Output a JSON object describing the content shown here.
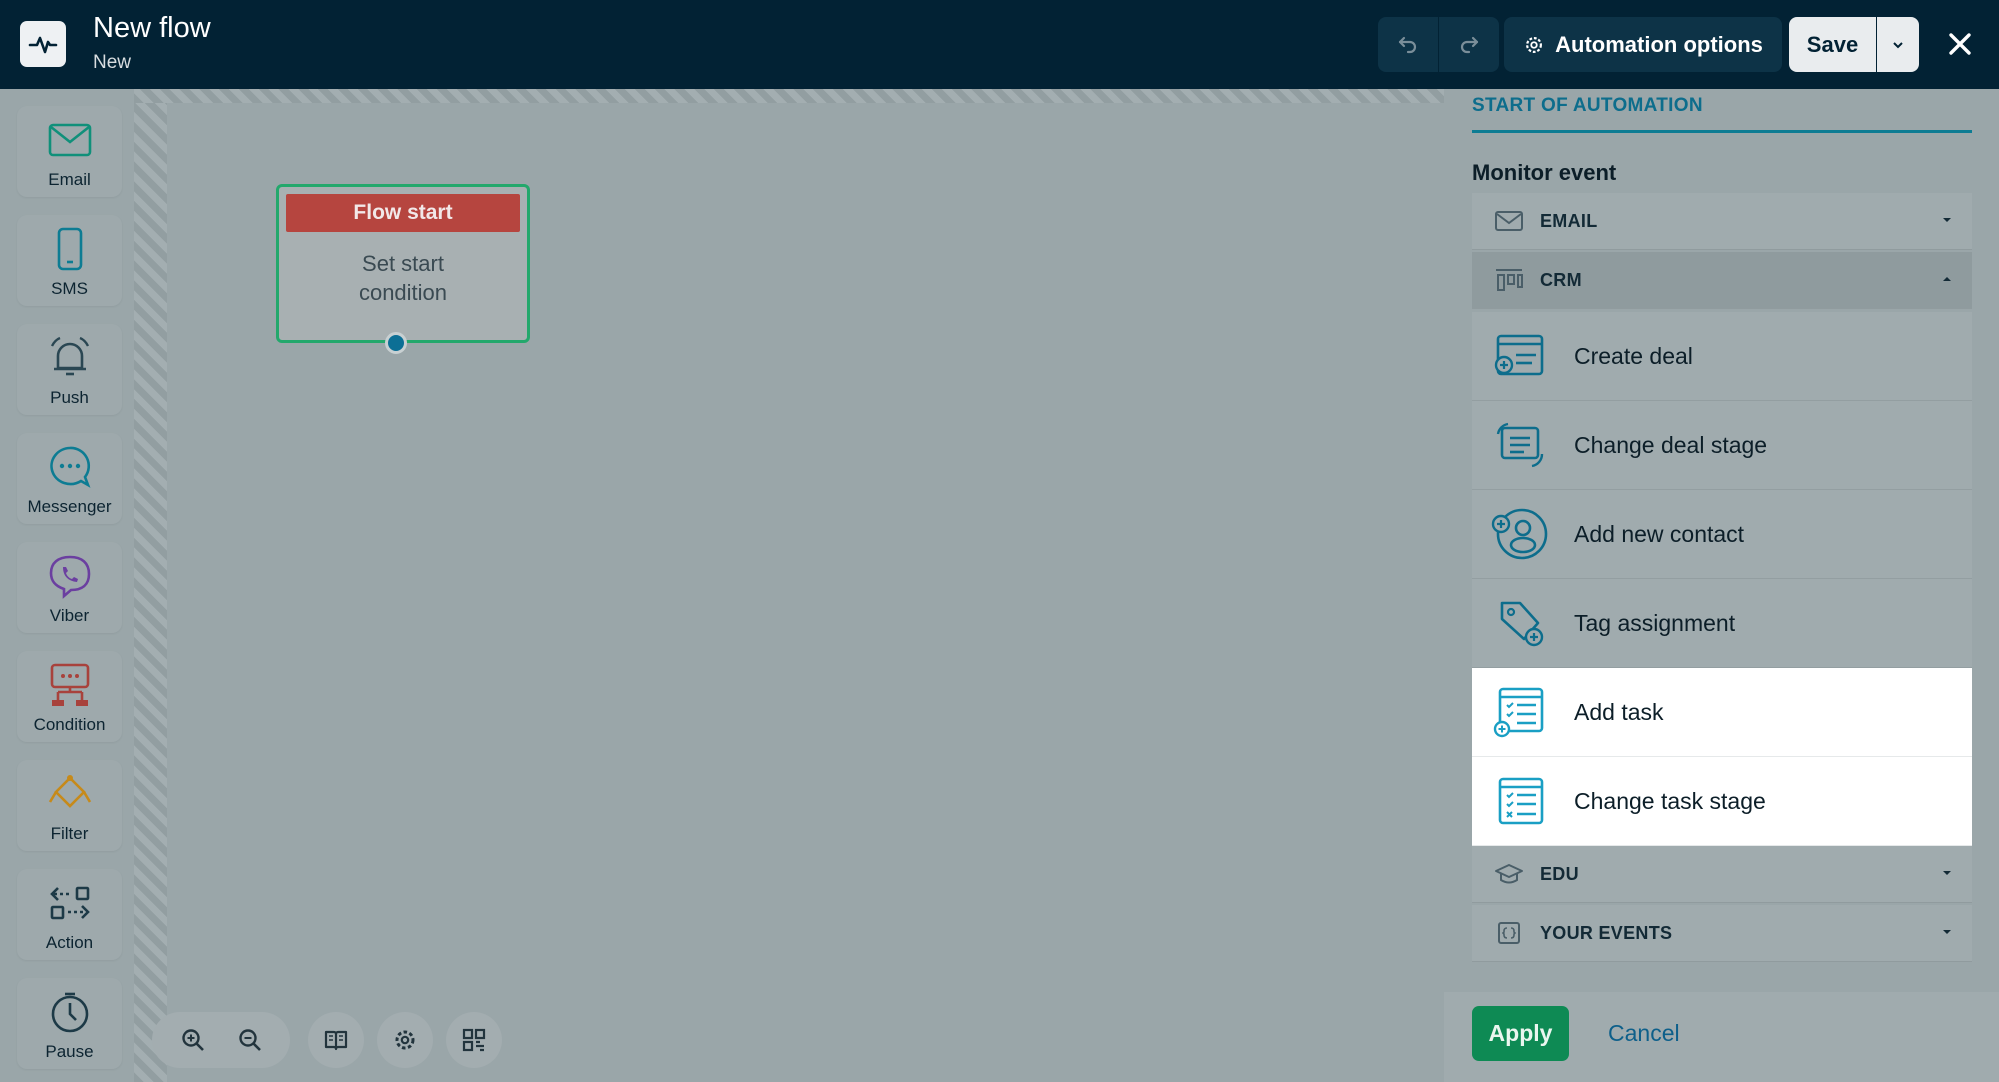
{
  "header": {
    "title": "New flow",
    "subtitle": "New",
    "automation_options_label": "Automation options",
    "save_label": "Save"
  },
  "toolbox": [
    {
      "label": "Email",
      "icon": "envelope-icon"
    },
    {
      "label": "SMS",
      "icon": "phone-icon"
    },
    {
      "label": "Push",
      "icon": "bell-icon"
    },
    {
      "label": "Messenger",
      "icon": "chat-bubble-icon"
    },
    {
      "label": "Viber",
      "icon": "viber-icon"
    },
    {
      "label": "Condition",
      "icon": "condition-icon"
    },
    {
      "label": "Filter",
      "icon": "filter-icon"
    },
    {
      "label": "Action",
      "icon": "action-icon"
    },
    {
      "label": "Pause",
      "icon": "clock-icon"
    }
  ],
  "canvas": {
    "node_title": "Flow start",
    "node_body_line1": "Set start",
    "node_body_line2": "condition"
  },
  "panel": {
    "section_title": "START OF AUTOMATION",
    "monitor_label": "Monitor event",
    "categories": {
      "email": "EMAIL",
      "crm": "CRM",
      "edu": "EDU",
      "your_events": "YOUR EVENTS"
    },
    "crm_items": [
      {
        "label": "Create deal",
        "icon": "create-deal-icon",
        "highlighted": false
      },
      {
        "label": "Change deal stage",
        "icon": "change-deal-stage-icon",
        "highlighted": false
      },
      {
        "label": "Add new contact",
        "icon": "add-contact-icon",
        "highlighted": false
      },
      {
        "label": "Tag assignment",
        "icon": "tag-icon",
        "highlighted": false
      },
      {
        "label": "Add task",
        "icon": "add-task-icon",
        "highlighted": true
      },
      {
        "label": "Change task stage",
        "icon": "change-task-stage-icon",
        "highlighted": true
      }
    ],
    "apply_label": "Apply",
    "cancel_label": "Cancel"
  },
  "colors": {
    "header_bg": "#022234",
    "accent_teal": "#0d7c93",
    "flow_head_red": "#b6453f",
    "apply_green": "#0e8a54",
    "node_border_green": "#23a86c"
  }
}
